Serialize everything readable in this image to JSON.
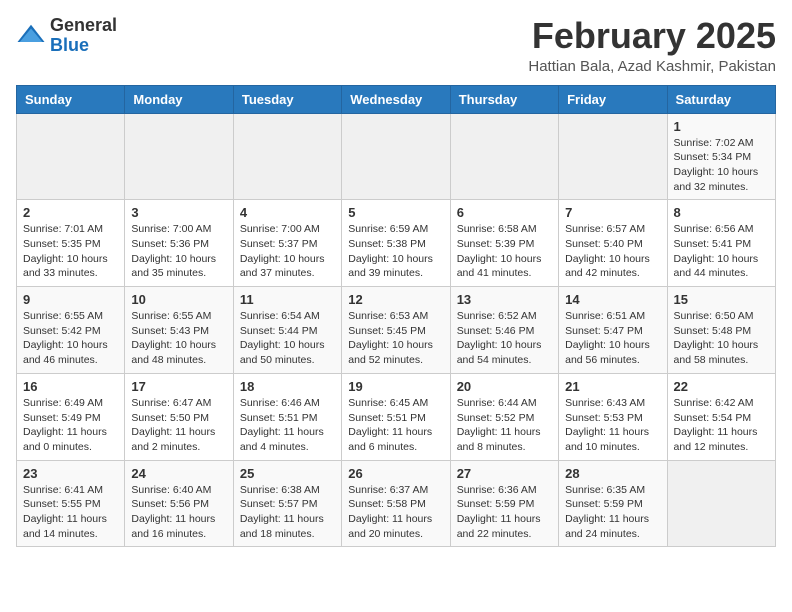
{
  "logo": {
    "general": "General",
    "blue": "Blue"
  },
  "title": {
    "month_year": "February 2025",
    "location": "Hattian Bala, Azad Kashmir, Pakistan"
  },
  "calendar": {
    "headers": [
      "Sunday",
      "Monday",
      "Tuesday",
      "Wednesday",
      "Thursday",
      "Friday",
      "Saturday"
    ],
    "weeks": [
      [
        {
          "day": "",
          "info": ""
        },
        {
          "day": "",
          "info": ""
        },
        {
          "day": "",
          "info": ""
        },
        {
          "day": "",
          "info": ""
        },
        {
          "day": "",
          "info": ""
        },
        {
          "day": "",
          "info": ""
        },
        {
          "day": "1",
          "info": "Sunrise: 7:02 AM\nSunset: 5:34 PM\nDaylight: 10 hours and 32 minutes."
        }
      ],
      [
        {
          "day": "2",
          "info": "Sunrise: 7:01 AM\nSunset: 5:35 PM\nDaylight: 10 hours and 33 minutes."
        },
        {
          "day": "3",
          "info": "Sunrise: 7:00 AM\nSunset: 5:36 PM\nDaylight: 10 hours and 35 minutes."
        },
        {
          "day": "4",
          "info": "Sunrise: 7:00 AM\nSunset: 5:37 PM\nDaylight: 10 hours and 37 minutes."
        },
        {
          "day": "5",
          "info": "Sunrise: 6:59 AM\nSunset: 5:38 PM\nDaylight: 10 hours and 39 minutes."
        },
        {
          "day": "6",
          "info": "Sunrise: 6:58 AM\nSunset: 5:39 PM\nDaylight: 10 hours and 41 minutes."
        },
        {
          "day": "7",
          "info": "Sunrise: 6:57 AM\nSunset: 5:40 PM\nDaylight: 10 hours and 42 minutes."
        },
        {
          "day": "8",
          "info": "Sunrise: 6:56 AM\nSunset: 5:41 PM\nDaylight: 10 hours and 44 minutes."
        }
      ],
      [
        {
          "day": "9",
          "info": "Sunrise: 6:55 AM\nSunset: 5:42 PM\nDaylight: 10 hours and 46 minutes."
        },
        {
          "day": "10",
          "info": "Sunrise: 6:55 AM\nSunset: 5:43 PM\nDaylight: 10 hours and 48 minutes."
        },
        {
          "day": "11",
          "info": "Sunrise: 6:54 AM\nSunset: 5:44 PM\nDaylight: 10 hours and 50 minutes."
        },
        {
          "day": "12",
          "info": "Sunrise: 6:53 AM\nSunset: 5:45 PM\nDaylight: 10 hours and 52 minutes."
        },
        {
          "day": "13",
          "info": "Sunrise: 6:52 AM\nSunset: 5:46 PM\nDaylight: 10 hours and 54 minutes."
        },
        {
          "day": "14",
          "info": "Sunrise: 6:51 AM\nSunset: 5:47 PM\nDaylight: 10 hours and 56 minutes."
        },
        {
          "day": "15",
          "info": "Sunrise: 6:50 AM\nSunset: 5:48 PM\nDaylight: 10 hours and 58 minutes."
        }
      ],
      [
        {
          "day": "16",
          "info": "Sunrise: 6:49 AM\nSunset: 5:49 PM\nDaylight: 11 hours and 0 minutes."
        },
        {
          "day": "17",
          "info": "Sunrise: 6:47 AM\nSunset: 5:50 PM\nDaylight: 11 hours and 2 minutes."
        },
        {
          "day": "18",
          "info": "Sunrise: 6:46 AM\nSunset: 5:51 PM\nDaylight: 11 hours and 4 minutes."
        },
        {
          "day": "19",
          "info": "Sunrise: 6:45 AM\nSunset: 5:51 PM\nDaylight: 11 hours and 6 minutes."
        },
        {
          "day": "20",
          "info": "Sunrise: 6:44 AM\nSunset: 5:52 PM\nDaylight: 11 hours and 8 minutes."
        },
        {
          "day": "21",
          "info": "Sunrise: 6:43 AM\nSunset: 5:53 PM\nDaylight: 11 hours and 10 minutes."
        },
        {
          "day": "22",
          "info": "Sunrise: 6:42 AM\nSunset: 5:54 PM\nDaylight: 11 hours and 12 minutes."
        }
      ],
      [
        {
          "day": "23",
          "info": "Sunrise: 6:41 AM\nSunset: 5:55 PM\nDaylight: 11 hours and 14 minutes."
        },
        {
          "day": "24",
          "info": "Sunrise: 6:40 AM\nSunset: 5:56 PM\nDaylight: 11 hours and 16 minutes."
        },
        {
          "day": "25",
          "info": "Sunrise: 6:38 AM\nSunset: 5:57 PM\nDaylight: 11 hours and 18 minutes."
        },
        {
          "day": "26",
          "info": "Sunrise: 6:37 AM\nSunset: 5:58 PM\nDaylight: 11 hours and 20 minutes."
        },
        {
          "day": "27",
          "info": "Sunrise: 6:36 AM\nSunset: 5:59 PM\nDaylight: 11 hours and 22 minutes."
        },
        {
          "day": "28",
          "info": "Sunrise: 6:35 AM\nSunset: 5:59 PM\nDaylight: 11 hours and 24 minutes."
        },
        {
          "day": "",
          "info": ""
        }
      ]
    ]
  }
}
